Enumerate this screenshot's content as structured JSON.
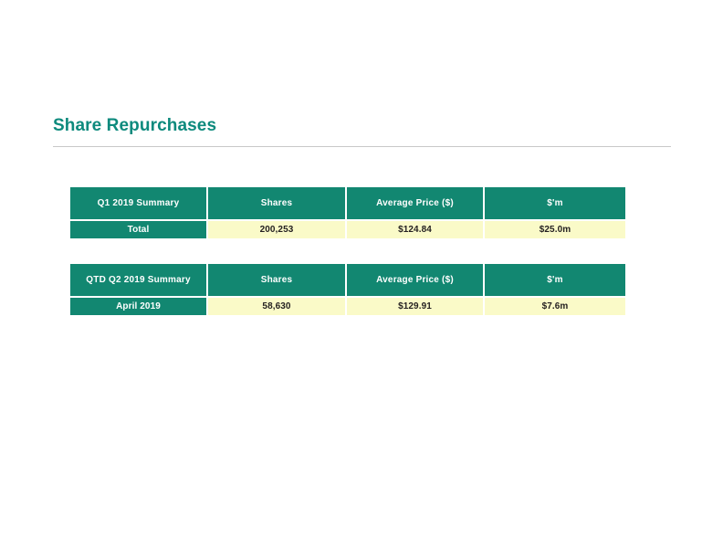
{
  "slide": {
    "title": "Share Repurchases"
  },
  "tables": [
    {
      "id": "q1",
      "name": "q1-2019-summary-table",
      "headers": [
        "Q1 2019 Summary",
        "Shares",
        "Average Price ($)",
        "$'m"
      ],
      "rows": [
        {
          "label": "Total",
          "shares": "200,253",
          "average_price": "$124.84",
          "value_millions": "$25.0m"
        }
      ]
    },
    {
      "id": "qtd",
      "name": "qtd-q2-2019-summary-table",
      "headers": [
        "QTD Q2 2019 Summary",
        "Shares",
        "Average Price ($)",
        "$'m"
      ],
      "rows": [
        {
          "label": "April 2019",
          "shares": "58,630",
          "average_price": "$129.91",
          "value_millions": "$7.6m"
        }
      ]
    }
  ],
  "colors": {
    "title_teal": "#0d8a7d",
    "header_teal": "#128771",
    "row_yellow": "#fafac8",
    "rule_gray": "#c8c8c8",
    "body_text": "#231f20"
  }
}
